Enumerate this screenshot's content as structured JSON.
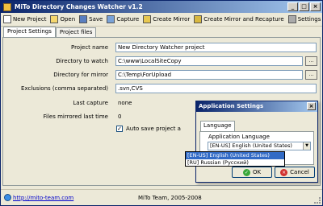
{
  "window": {
    "title": "MiTo Directory Changes Watcher v1.2"
  },
  "toolbar": {
    "new_project": "New Project",
    "open": "Open",
    "save": "Save",
    "capture": "Capture",
    "create_mirror": "Create Mirror",
    "create_mirror_recapture": "Create Mirror and Recapture",
    "settings": "Settings"
  },
  "tabs": [
    "Project Settings",
    "Project files"
  ],
  "form": {
    "project_name_label": "Project name",
    "project_name_value": "New Directory Watcher project",
    "watch_label": "Directory to watch",
    "watch_value": "C:\\www\\LocalSiteCopy",
    "mirror_label": "Directory for mirror",
    "mirror_value": "C:\\Temp\\ForUpload",
    "exclusions_label": "Exclusions (comma separated)",
    "exclusions_value": ".svn,CVS",
    "last_capture_label": "Last capture",
    "last_capture_value": "none",
    "files_mirrored_label": "Files mirrored last time",
    "files_mirrored_value": "0",
    "autosave_label": "Auto save project a",
    "browse_label": "..."
  },
  "status": {
    "link": "http://mito-team.com",
    "credit": "MiTo Team, 2005-2008"
  },
  "dialog": {
    "title": "Application Settings",
    "tab": "Language",
    "lang_label": "Application Language",
    "selected": "[EN-US] English (United States)",
    "options": [
      "[EN-US] English (United States)",
      "[RU] Russian (Русский)"
    ],
    "ok": "OK",
    "cancel": "Cancel"
  }
}
